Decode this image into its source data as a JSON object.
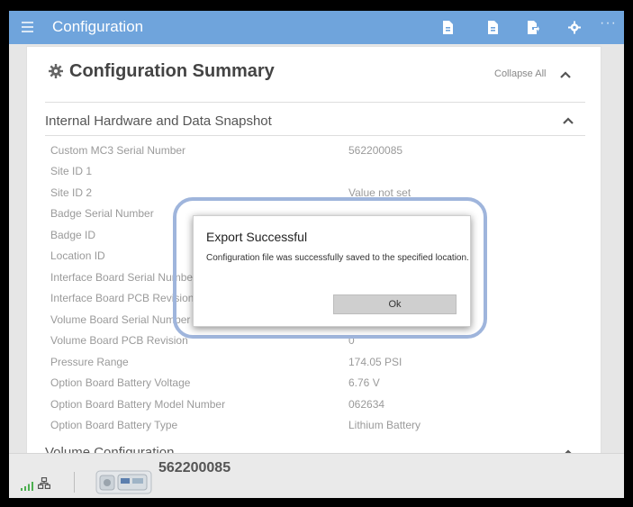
{
  "titlebar": {
    "title": "Configuration",
    "icons": [
      "file-icon",
      "file-icon",
      "export-icon",
      "settings-icon"
    ],
    "more": "···",
    "color": "#6fa4dc"
  },
  "card": {
    "title": "Configuration Summary",
    "collapse_all_label": "Collapse All"
  },
  "sections": [
    {
      "title": "Internal Hardware and Data Snapshot"
    },
    {
      "title": "Volume Configuration"
    }
  ],
  "rows": [
    {
      "label": "Custom MC3 Serial Number",
      "value": "562200085"
    },
    {
      "label": "Site ID 1",
      "value": ""
    },
    {
      "label": "Site ID 2",
      "value": "Value not set"
    },
    {
      "label": "Badge Serial Number",
      "value": ""
    },
    {
      "label": "Badge ID",
      "value": ""
    },
    {
      "label": "Location ID",
      "value": ""
    },
    {
      "label": "Interface Board Serial Number",
      "value": ""
    },
    {
      "label": "Interface Board PCB Revision",
      "value": ""
    },
    {
      "label": "Volume Board Serial Number",
      "value": ""
    },
    {
      "label": "Volume Board PCB Revision",
      "value": "0"
    },
    {
      "label": "Pressure Range",
      "value": "174.05 PSI"
    },
    {
      "label": "Option Board Battery Voltage",
      "value": "6.76 V"
    },
    {
      "label": "Option Board Battery Model Number",
      "value": "062634"
    },
    {
      "label": "Option Board Battery Type",
      "value": "Lithium Battery"
    }
  ],
  "dialog": {
    "title": "Export Successful",
    "message": "Configuration file was successfully saved to the specified location.",
    "ok_label": "Ok"
  },
  "statusbar": {
    "serial": "562200085"
  }
}
